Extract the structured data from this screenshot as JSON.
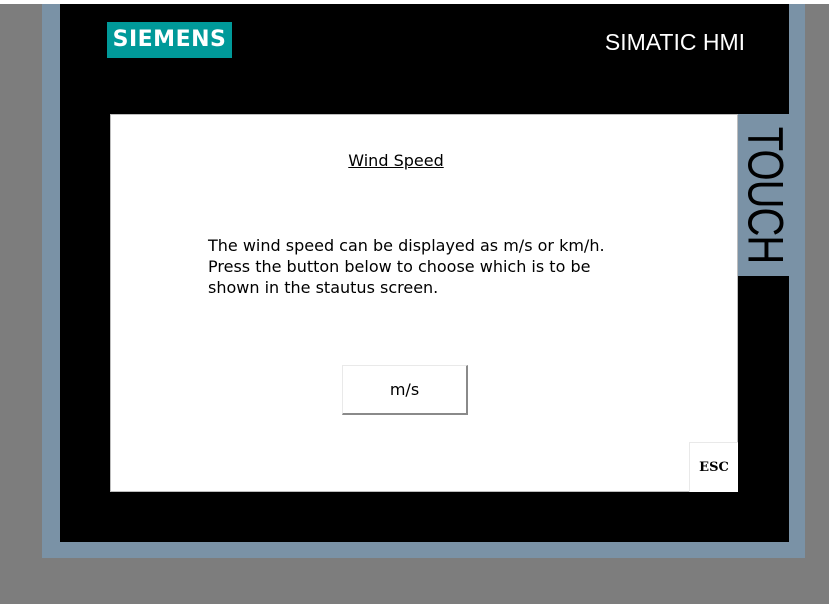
{
  "device": {
    "brand": "SIEMENS",
    "product": "SIMATIC HMI",
    "touch_label": "TOUCH",
    "colors": {
      "outer_background": "#7d7d7d",
      "bezel": "#000000",
      "frame": "#7a92a6",
      "brand_accent": "#009999",
      "screen": "#ffffff"
    }
  },
  "screen": {
    "title": "Wind Speed",
    "description": [
      "The wind speed can be displayed as m/s or km/h.",
      "Press the button below to choose which is to be",
      "shown in the stautus screen."
    ],
    "unit_button_label": "m/s",
    "esc_button_label": "ESC"
  }
}
